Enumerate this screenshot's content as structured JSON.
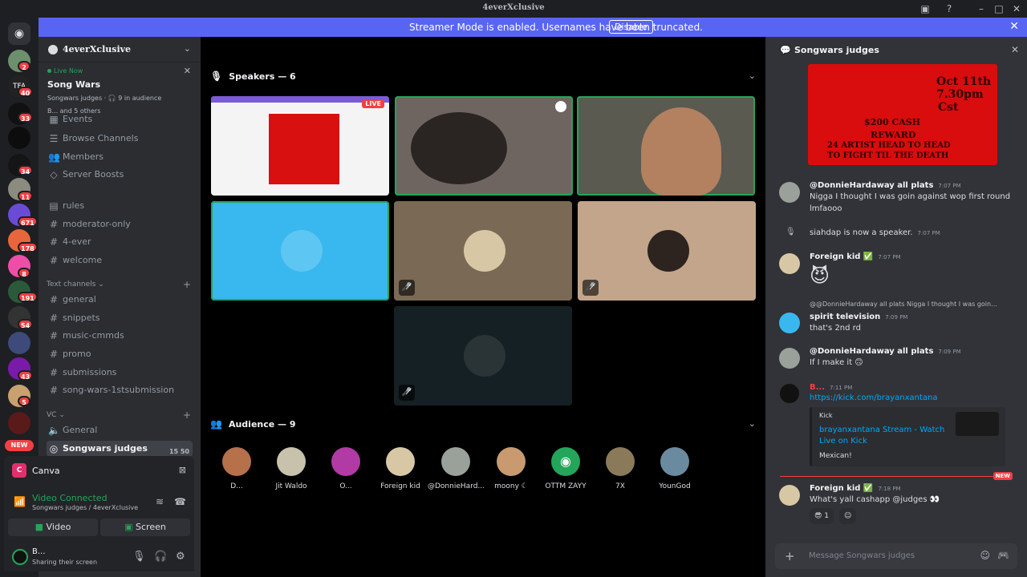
{
  "window": {
    "title": "4everXclusive"
  },
  "banner": {
    "message": "Streamer Mode is enabled. Usernames have been truncated.",
    "disable_label": "Disable"
  },
  "guild_badges": [
    "2",
    "40",
    "33",
    "34",
    "11",
    "671",
    "178",
    "8",
    "191",
    "54",
    "43",
    "5"
  ],
  "guild_new_label": "NEW",
  "guild_tfa": "TFA",
  "server": {
    "name": "4everXclusive"
  },
  "live": {
    "label": "Live Now",
    "title": "Song Wars",
    "sub": "Songwars judges  ·  🎧 9 in audience",
    "users": "B... and 5 others"
  },
  "channels": {
    "events": "Events",
    "browse": "Browse Channels",
    "members": "Members",
    "boosts": "Server Boosts",
    "top": [
      "rules",
      "moderator-only",
      "4-ever",
      "welcome"
    ],
    "text_category": "Text channels",
    "text": [
      "general",
      "snippets",
      "music-cmmds",
      "promo",
      "submissions",
      "song-wars-1stsubmission"
    ],
    "vc_category": "VC",
    "vc": [
      "General",
      "Songwars judges"
    ],
    "vc_counts": "15   50"
  },
  "activity": {
    "name": "Canva"
  },
  "voice": {
    "status": "Video Connected",
    "channel": "Songwars judges / 4everXclusive",
    "video_label": "Video",
    "screen_label": "Screen"
  },
  "user": {
    "name": "B...",
    "status": "Sharing their screen"
  },
  "stage": {
    "speakers_label": "Speakers — 6",
    "audience_label": "Audience — 9",
    "live_tag": "LIVE",
    "audience": [
      "D...",
      "Jit Waldo",
      "O...",
      "Foreign kid",
      "@DonnieHard...",
      "moony ☾",
      "OTTM ZAYY",
      "7X",
      "YounGod"
    ]
  },
  "chat": {
    "title": "Songwars judges",
    "poster": {
      "l1": "Oct 11th",
      "l2": "7.30pm",
      "l3": "Cst",
      "l4": "$200 CASH",
      "l5": "REWARD",
      "l6": "24 ARTIST HEAD TO HEAD",
      "l7": "TO FIGHT TIL THE DEATH"
    },
    "m1": {
      "name": "@DonnieHardaway all plats",
      "time": "7:07 PM",
      "line1": "Nigga I thought I was goin against wop first round",
      "line2": "lmfaooo"
    },
    "m2": {
      "text": "siahdap is now a speaker.",
      "time": "7:07 PM"
    },
    "m3": {
      "name": "Foreign kid ✅",
      "time": "7:07 PM",
      "emoji": "😈"
    },
    "m4": {
      "reply": "@@DonnieHardaway all plats Nigga I thought I was goin...",
      "name": "spirit television",
      "time": "7:09 PM",
      "text": "that's 2nd rd"
    },
    "m5": {
      "name": "@DonnieHardaway all plats",
      "time": "7:09 PM",
      "text": "If I make it 🙃"
    },
    "m6": {
      "name": "B...",
      "time": "7:11 PM",
      "link": "https://kick.com/brayanxantana"
    },
    "embed": {
      "provider": "Kick",
      "title": "brayanxantana Stream - Watch Live on Kick",
      "desc": "Mexican!"
    },
    "new_label": "NEW",
    "m7": {
      "name": "Foreign kid ✅",
      "time": "7:18 PM",
      "text": "What's yall cashapp @judges 👀"
    },
    "reaction": "😎 1",
    "placeholder": "Message Songwars judges"
  },
  "colors": {
    "accent": "#5865f2",
    "green": "#23a55a",
    "red": "#f23f43",
    "tile_blue": "#38b8ee",
    "tile_tan": "#7a6a55"
  }
}
